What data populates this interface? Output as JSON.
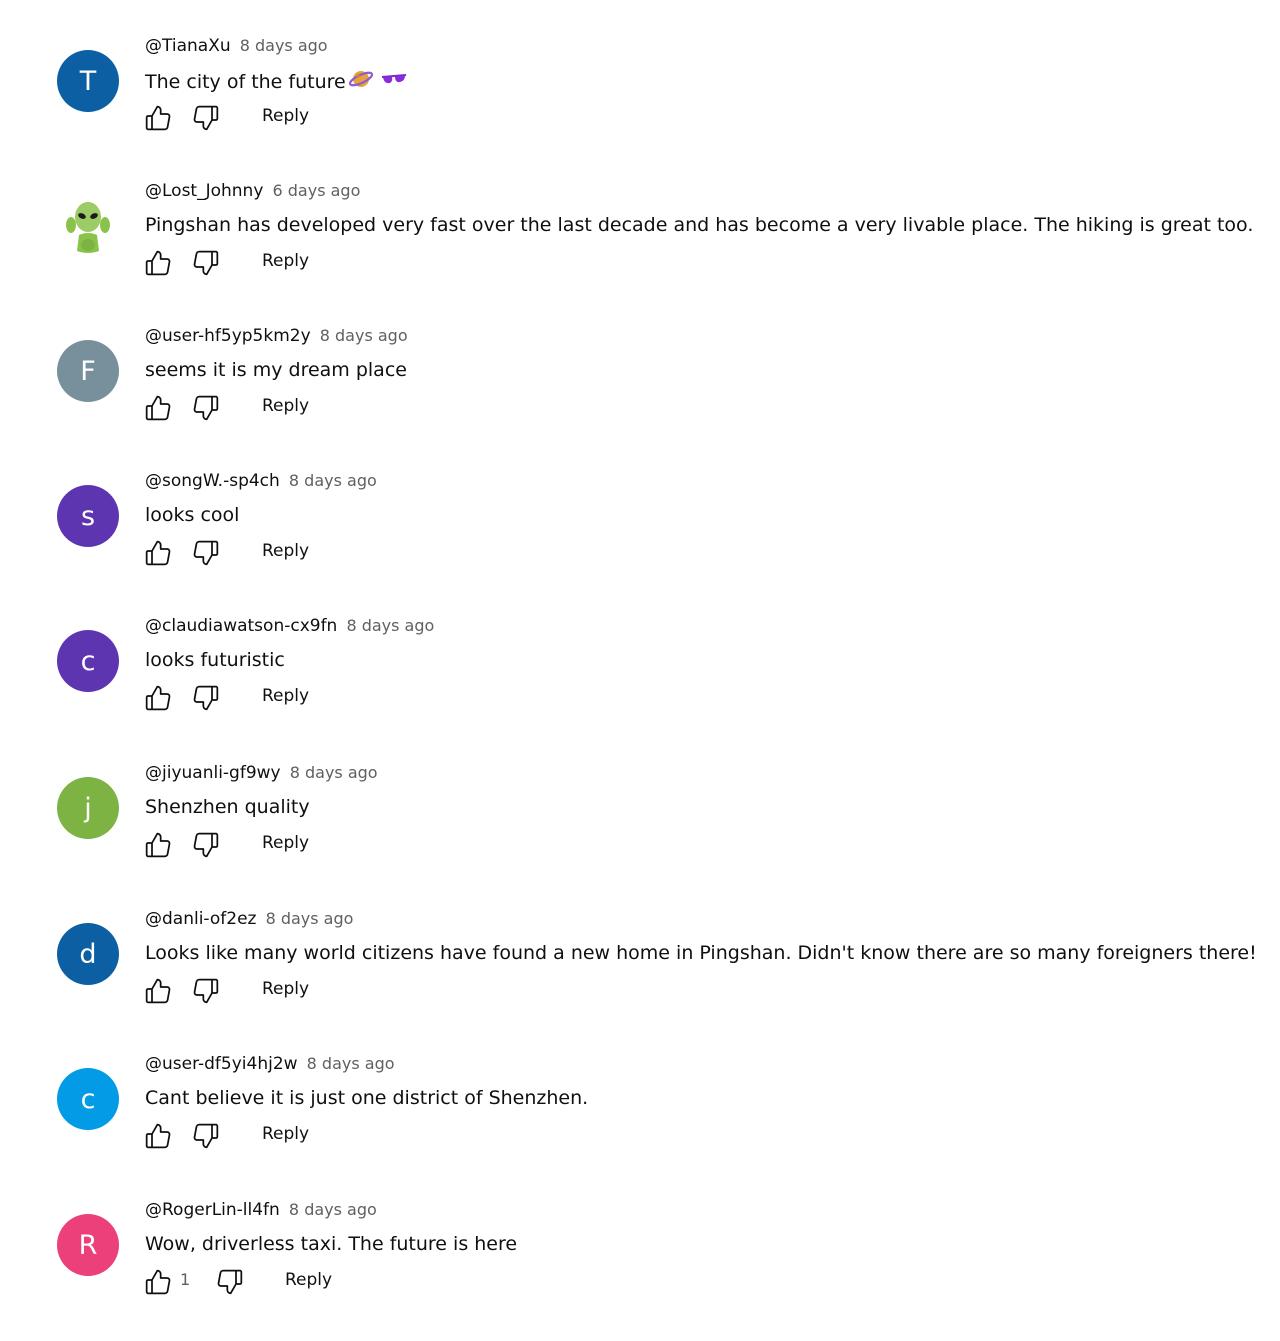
{
  "comments": [
    {
      "author": "@TianaXu",
      "time": "8 days ago",
      "text": "The city of the future",
      "emoji": "🪐🕶",
      "avatar_letter": "T",
      "avatar_color": "#0d5fa3",
      "reply": "Reply",
      "likes": ""
    },
    {
      "author": "@Lost_Johnny",
      "time": "6 days ago",
      "text": "Pingshan has developed very fast over the last decade and has become a very livable place. The hiking is great too.",
      "avatar_letter": "",
      "avatar_color": "#ffffff",
      "avatar_icon": "alien-avatar-icon",
      "reply": "Reply",
      "likes": ""
    },
    {
      "author": "@user-hf5yp5km2y",
      "time": "8 days ago",
      "text": "seems it is my dream place",
      "avatar_letter": "F",
      "avatar_color": "#78909c",
      "reply": "Reply",
      "likes": ""
    },
    {
      "author": "@songW.-sp4ch",
      "time": "8 days ago",
      "text": "looks cool",
      "avatar_letter": "s",
      "avatar_color": "#5e35b1",
      "reply": "Reply",
      "likes": ""
    },
    {
      "author": "@claudiawatson-cx9fn",
      "time": "8 days ago",
      "text": "looks futuristic",
      "avatar_letter": "c",
      "avatar_color": "#5e35b1",
      "reply": "Reply",
      "likes": ""
    },
    {
      "author": "@jiyuanli-gf9wy",
      "time": "8 days ago",
      "text": "Shenzhen quality",
      "avatar_letter": "j",
      "avatar_color": "#7cb342",
      "reply": "Reply",
      "likes": ""
    },
    {
      "author": "@danli-of2ez",
      "time": "8 days ago",
      "text": "Looks like many world citizens have found a new home in Pingshan. Didn't know there are so many foreigners there!",
      "avatar_letter": "d",
      "avatar_color": "#0d5fa3",
      "reply": "Reply",
      "likes": ""
    },
    {
      "author": "@user-df5yi4hj2w",
      "time": "8 days ago",
      "text": "Cant believe it is just one district of Shenzhen.",
      "avatar_letter": "c",
      "avatar_color": "#039be5",
      "reply": "Reply",
      "likes": ""
    },
    {
      "author": "@RogerLin-ll4fn",
      "time": "8 days ago",
      "text": "Wow, driverless taxi. The future is here",
      "avatar_letter": "R",
      "avatar_color": "#ec407a",
      "reply": "Reply",
      "likes": "1"
    }
  ]
}
